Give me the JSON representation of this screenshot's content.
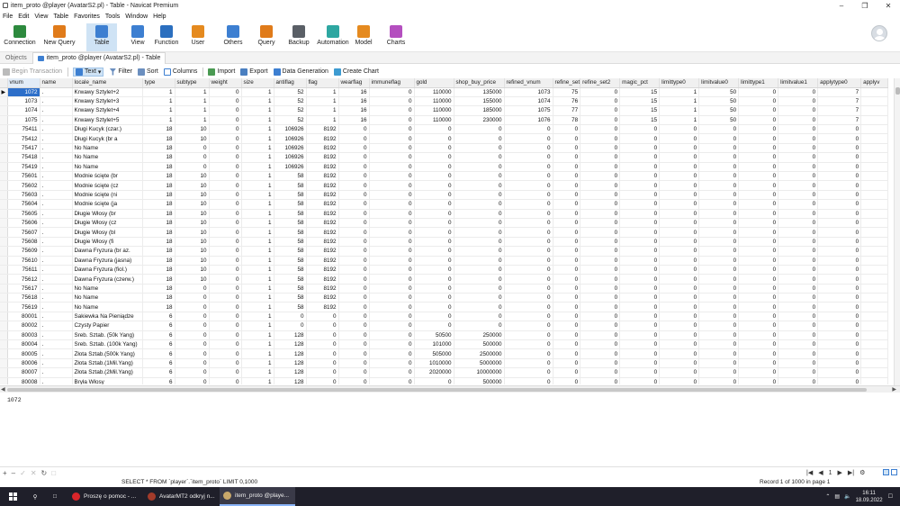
{
  "window": {
    "title": "item_proto @player (AvatarS2.pl) - Table - Navicat Premium"
  },
  "menu": [
    "File",
    "Edit",
    "View",
    "Table",
    "Favorites",
    "Tools",
    "Window",
    "Help"
  ],
  "ribbon": [
    {
      "label": "Connection",
      "icon": "connection-icon",
      "color": "#2d8a3e"
    },
    {
      "label": "New Query",
      "icon": "new-query-icon",
      "color": "#e07b1a"
    },
    {
      "label": "Table",
      "icon": "table-icon",
      "color": "#3d7fd1"
    },
    {
      "label": "View",
      "icon": "view-icon",
      "color": "#3d7fd1"
    },
    {
      "label": "Function",
      "icon": "function-icon",
      "color": "#2b6fbf"
    },
    {
      "label": "User",
      "icon": "user-icon",
      "color": "#e58a1f"
    },
    {
      "label": "Others",
      "icon": "others-icon",
      "color": "#3d7fd1"
    },
    {
      "label": "Query",
      "icon": "query-icon",
      "color": "#e07b1a"
    },
    {
      "label": "Backup",
      "icon": "backup-icon",
      "color": "#5a5f66"
    },
    {
      "label": "Automation",
      "icon": "automation-icon",
      "color": "#2ea7a1"
    },
    {
      "label": "Model",
      "icon": "model-icon",
      "color": "#e58a1f"
    },
    {
      "label": "Charts",
      "icon": "charts-icon",
      "color": "#b44fbf"
    }
  ],
  "tabs": {
    "objects": "Objects",
    "doc": "item_proto @player (AvatarS2.pl) - Table"
  },
  "toolbar": {
    "begin": "Begin Transaction",
    "text": "Text",
    "filter": "Filter",
    "sort": "Sort",
    "columns": "Columns",
    "import": "Import",
    "export": "Export",
    "datagen": "Data Generation",
    "chart": "Create Chart"
  },
  "columns": [
    "vnum",
    "name",
    "locale_name",
    "type",
    "subtype",
    "weight",
    "size",
    "antiflag",
    "flag",
    "wearflag",
    "immuneflag",
    "gold",
    "shop_buy_price",
    "refined_vnum",
    "refine_set",
    "refine_set2",
    "magic_pct",
    "limittype0",
    "limitvalue0",
    "limittype1",
    "limitvalue1",
    "applytype0",
    "applyv"
  ],
  "rows": [
    [
      "1072",
      ".",
      "Krwawy Sztylet+2",
      "1",
      "1",
      "0",
      "1",
      "52",
      "1",
      "16",
      "0",
      "110000",
      "135000",
      "1073",
      "75",
      "0",
      "15",
      "1",
      "50",
      "0",
      "0",
      "7",
      ""
    ],
    [
      "1073",
      ".",
      "Krwawy Sztylet+3",
      "1",
      "1",
      "0",
      "1",
      "52",
      "1",
      "16",
      "0",
      "110000",
      "155000",
      "1074",
      "76",
      "0",
      "15",
      "1",
      "50",
      "0",
      "0",
      "7",
      ""
    ],
    [
      "1074",
      ".",
      "Krwawy Sztylet+4",
      "1",
      "1",
      "0",
      "1",
      "52",
      "1",
      "16",
      "0",
      "110000",
      "185000",
      "1075",
      "77",
      "0",
      "15",
      "1",
      "50",
      "0",
      "0",
      "7",
      ""
    ],
    [
      "1075",
      ".",
      "Krwawy Sztylet+5",
      "1",
      "1",
      "0",
      "1",
      "52",
      "1",
      "16",
      "0",
      "110000",
      "230000",
      "1076",
      "78",
      "0",
      "15",
      "1",
      "50",
      "0",
      "0",
      "7",
      ""
    ],
    [
      "75411",
      ".",
      "Długi Kucyk (czar.)",
      "18",
      "10",
      "0",
      "1",
      "106926",
      "8192",
      "0",
      "0",
      "0",
      "0",
      "0",
      "0",
      "0",
      "0",
      "0",
      "0",
      "0",
      "0",
      "0",
      ""
    ],
    [
      "75412",
      ".",
      "Długi Kucyk (br a",
      "18",
      "10",
      "0",
      "1",
      "106926",
      "8192",
      "0",
      "0",
      "0",
      "0",
      "0",
      "0",
      "0",
      "0",
      "0",
      "0",
      "0",
      "0",
      "0",
      ""
    ],
    [
      "75417",
      ".",
      "No Name",
      "18",
      "0",
      "0",
      "1",
      "106926",
      "8192",
      "0",
      "0",
      "0",
      "0",
      "0",
      "0",
      "0",
      "0",
      "0",
      "0",
      "0",
      "0",
      "0",
      ""
    ],
    [
      "75418",
      ".",
      "No Name",
      "18",
      "0",
      "0",
      "1",
      "106926",
      "8192",
      "0",
      "0",
      "0",
      "0",
      "0",
      "0",
      "0",
      "0",
      "0",
      "0",
      "0",
      "0",
      "0",
      ""
    ],
    [
      "75419",
      ".",
      "No Name",
      "18",
      "0",
      "0",
      "1",
      "106926",
      "8192",
      "0",
      "0",
      "0",
      "0",
      "0",
      "0",
      "0",
      "0",
      "0",
      "0",
      "0",
      "0",
      "0",
      ""
    ],
    [
      "75601",
      ".",
      "Modnie ścięte (br",
      "18",
      "10",
      "0",
      "1",
      "58",
      "8192",
      "0",
      "0",
      "0",
      "0",
      "0",
      "0",
      "0",
      "0",
      "0",
      "0",
      "0",
      "0",
      "0",
      ""
    ],
    [
      "75602",
      ".",
      "Modnie ścięte (cz",
      "18",
      "10",
      "0",
      "1",
      "58",
      "8192",
      "0",
      "0",
      "0",
      "0",
      "0",
      "0",
      "0",
      "0",
      "0",
      "0",
      "0",
      "0",
      "0",
      ""
    ],
    [
      "75603",
      ".",
      "Modnie ścięte (ni",
      "18",
      "10",
      "0",
      "1",
      "58",
      "8192",
      "0",
      "0",
      "0",
      "0",
      "0",
      "0",
      "0",
      "0",
      "0",
      "0",
      "0",
      "0",
      "0",
      ""
    ],
    [
      "75604",
      ".",
      "Modnie ścięte (ja",
      "18",
      "10",
      "0",
      "1",
      "58",
      "8192",
      "0",
      "0",
      "0",
      "0",
      "0",
      "0",
      "0",
      "0",
      "0",
      "0",
      "0",
      "0",
      "0",
      ""
    ],
    [
      "75605",
      ".",
      "Długie Włosy (br",
      "18",
      "10",
      "0",
      "1",
      "58",
      "8192",
      "0",
      "0",
      "0",
      "0",
      "0",
      "0",
      "0",
      "0",
      "0",
      "0",
      "0",
      "0",
      "0",
      ""
    ],
    [
      "75606",
      ".",
      "Długie Włosy (cz",
      "18",
      "10",
      "0",
      "1",
      "58",
      "8192",
      "0",
      "0",
      "0",
      "0",
      "0",
      "0",
      "0",
      "0",
      "0",
      "0",
      "0",
      "0",
      "0",
      ""
    ],
    [
      "75607",
      ".",
      "Długie Włosy (bl",
      "18",
      "10",
      "0",
      "1",
      "58",
      "8192",
      "0",
      "0",
      "0",
      "0",
      "0",
      "0",
      "0",
      "0",
      "0",
      "0",
      "0",
      "0",
      "0",
      ""
    ],
    [
      "75608",
      ".",
      "Długie Włosy (fi",
      "18",
      "10",
      "0",
      "1",
      "58",
      "8192",
      "0",
      "0",
      "0",
      "0",
      "0",
      "0",
      "0",
      "0",
      "0",
      "0",
      "0",
      "0",
      "0",
      ""
    ],
    [
      "75609",
      ".",
      "Dawna Fryzura (br az.",
      "18",
      "10",
      "0",
      "1",
      "58",
      "8192",
      "0",
      "0",
      "0",
      "0",
      "0",
      "0",
      "0",
      "0",
      "0",
      "0",
      "0",
      "0",
      "0",
      ""
    ],
    [
      "75610",
      ".",
      "Dawna Fryzura (jasna)",
      "18",
      "10",
      "0",
      "1",
      "58",
      "8192",
      "0",
      "0",
      "0",
      "0",
      "0",
      "0",
      "0",
      "0",
      "0",
      "0",
      "0",
      "0",
      "0",
      ""
    ],
    [
      "75611",
      ".",
      "Dawna Fryzura (fiol.)",
      "18",
      "10",
      "0",
      "1",
      "58",
      "8192",
      "0",
      "0",
      "0",
      "0",
      "0",
      "0",
      "0",
      "0",
      "0",
      "0",
      "0",
      "0",
      "0",
      ""
    ],
    [
      "75612",
      ".",
      "Dawna Fryzura (czerw.)",
      "18",
      "10",
      "0",
      "1",
      "58",
      "8192",
      "0",
      "0",
      "0",
      "0",
      "0",
      "0",
      "0",
      "0",
      "0",
      "0",
      "0",
      "0",
      "0",
      ""
    ],
    [
      "75617",
      ".",
      "No Name",
      "18",
      "0",
      "0",
      "1",
      "58",
      "8192",
      "0",
      "0",
      "0",
      "0",
      "0",
      "0",
      "0",
      "0",
      "0",
      "0",
      "0",
      "0",
      "0",
      ""
    ],
    [
      "75618",
      ".",
      "No Name",
      "18",
      "0",
      "0",
      "1",
      "58",
      "8192",
      "0",
      "0",
      "0",
      "0",
      "0",
      "0",
      "0",
      "0",
      "0",
      "0",
      "0",
      "0",
      "0",
      ""
    ],
    [
      "75619",
      ".",
      "No Name",
      "18",
      "0",
      "0",
      "1",
      "58",
      "8192",
      "0",
      "0",
      "0",
      "0",
      "0",
      "0",
      "0",
      "0",
      "0",
      "0",
      "0",
      "0",
      "0",
      ""
    ],
    [
      "80001",
      ".",
      "Sakiewka Na Pieniądze",
      "6",
      "0",
      "0",
      "1",
      "0",
      "0",
      "0",
      "0",
      "0",
      "0",
      "0",
      "0",
      "0",
      "0",
      "0",
      "0",
      "0",
      "0",
      "0",
      ""
    ],
    [
      "80002",
      ".",
      "Czysty Papier",
      "6",
      "0",
      "0",
      "1",
      "0",
      "0",
      "0",
      "0",
      "0",
      "0",
      "0",
      "0",
      "0",
      "0",
      "0",
      "0",
      "0",
      "0",
      "0",
      ""
    ],
    [
      "80003",
      ".",
      "Sreb. Sztab. (50k Yang)",
      "6",
      "0",
      "0",
      "1",
      "128",
      "0",
      "0",
      "0",
      "50500",
      "250000",
      "0",
      "0",
      "0",
      "0",
      "0",
      "0",
      "0",
      "0",
      "0",
      ""
    ],
    [
      "80004",
      ".",
      "Sreb. Sztab. (100k Yang)",
      "6",
      "0",
      "0",
      "1",
      "128",
      "0",
      "0",
      "0",
      "101000",
      "500000",
      "0",
      "0",
      "0",
      "0",
      "0",
      "0",
      "0",
      "0",
      "0",
      ""
    ],
    [
      "80005",
      ".",
      "Złota Sztab.(500k Yang)",
      "6",
      "0",
      "0",
      "1",
      "128",
      "0",
      "0",
      "0",
      "505000",
      "2500000",
      "0",
      "0",
      "0",
      "0",
      "0",
      "0",
      "0",
      "0",
      "0",
      ""
    ],
    [
      "80006",
      ".",
      "Złota Sztab.(1Mil.Yang)",
      "6",
      "0",
      "0",
      "1",
      "128",
      "0",
      "0",
      "0",
      "1010000",
      "5000000",
      "0",
      "0",
      "0",
      "0",
      "0",
      "0",
      "0",
      "0",
      "0",
      ""
    ],
    [
      "80007",
      ".",
      "Złota Sztab.(2Mil.Yang)",
      "6",
      "0",
      "0",
      "1",
      "128",
      "0",
      "0",
      "0",
      "2020000",
      "10000000",
      "0",
      "0",
      "0",
      "0",
      "0",
      "0",
      "0",
      "0",
      "0",
      ""
    ],
    [
      "80008",
      ".",
      "Bryła Włosy",
      "6",
      "0",
      "0",
      "1",
      "128",
      "0",
      "0",
      "0",
      "0",
      "500000",
      "0",
      "0",
      "0",
      "0",
      "0",
      "0",
      "0",
      "0",
      "0",
      ""
    ]
  ],
  "preview_value": "1072",
  "status": {
    "sql": "SELECT * FROM `player`.`item_proto` LIMIT 0,1000",
    "record": "Record 1 of 1000 in page 1",
    "page": "1"
  },
  "taskbar": [
    {
      "label": "Proszę o pomoc - ...",
      "icon": "opera-icon",
      "color": "#d9252a"
    },
    {
      "label": "AvatarMT2 odkryj n...",
      "icon": "game-icon",
      "color": "#a33b2a"
    },
    {
      "label": "item_proto @playe...",
      "icon": "navicat-icon",
      "color": "#c9a86a"
    }
  ],
  "clock": {
    "time": "16:11",
    "date": "18.09.2022"
  },
  "colors": {
    "selection": "#2d6fc9",
    "accent": "#3d7fd1"
  }
}
